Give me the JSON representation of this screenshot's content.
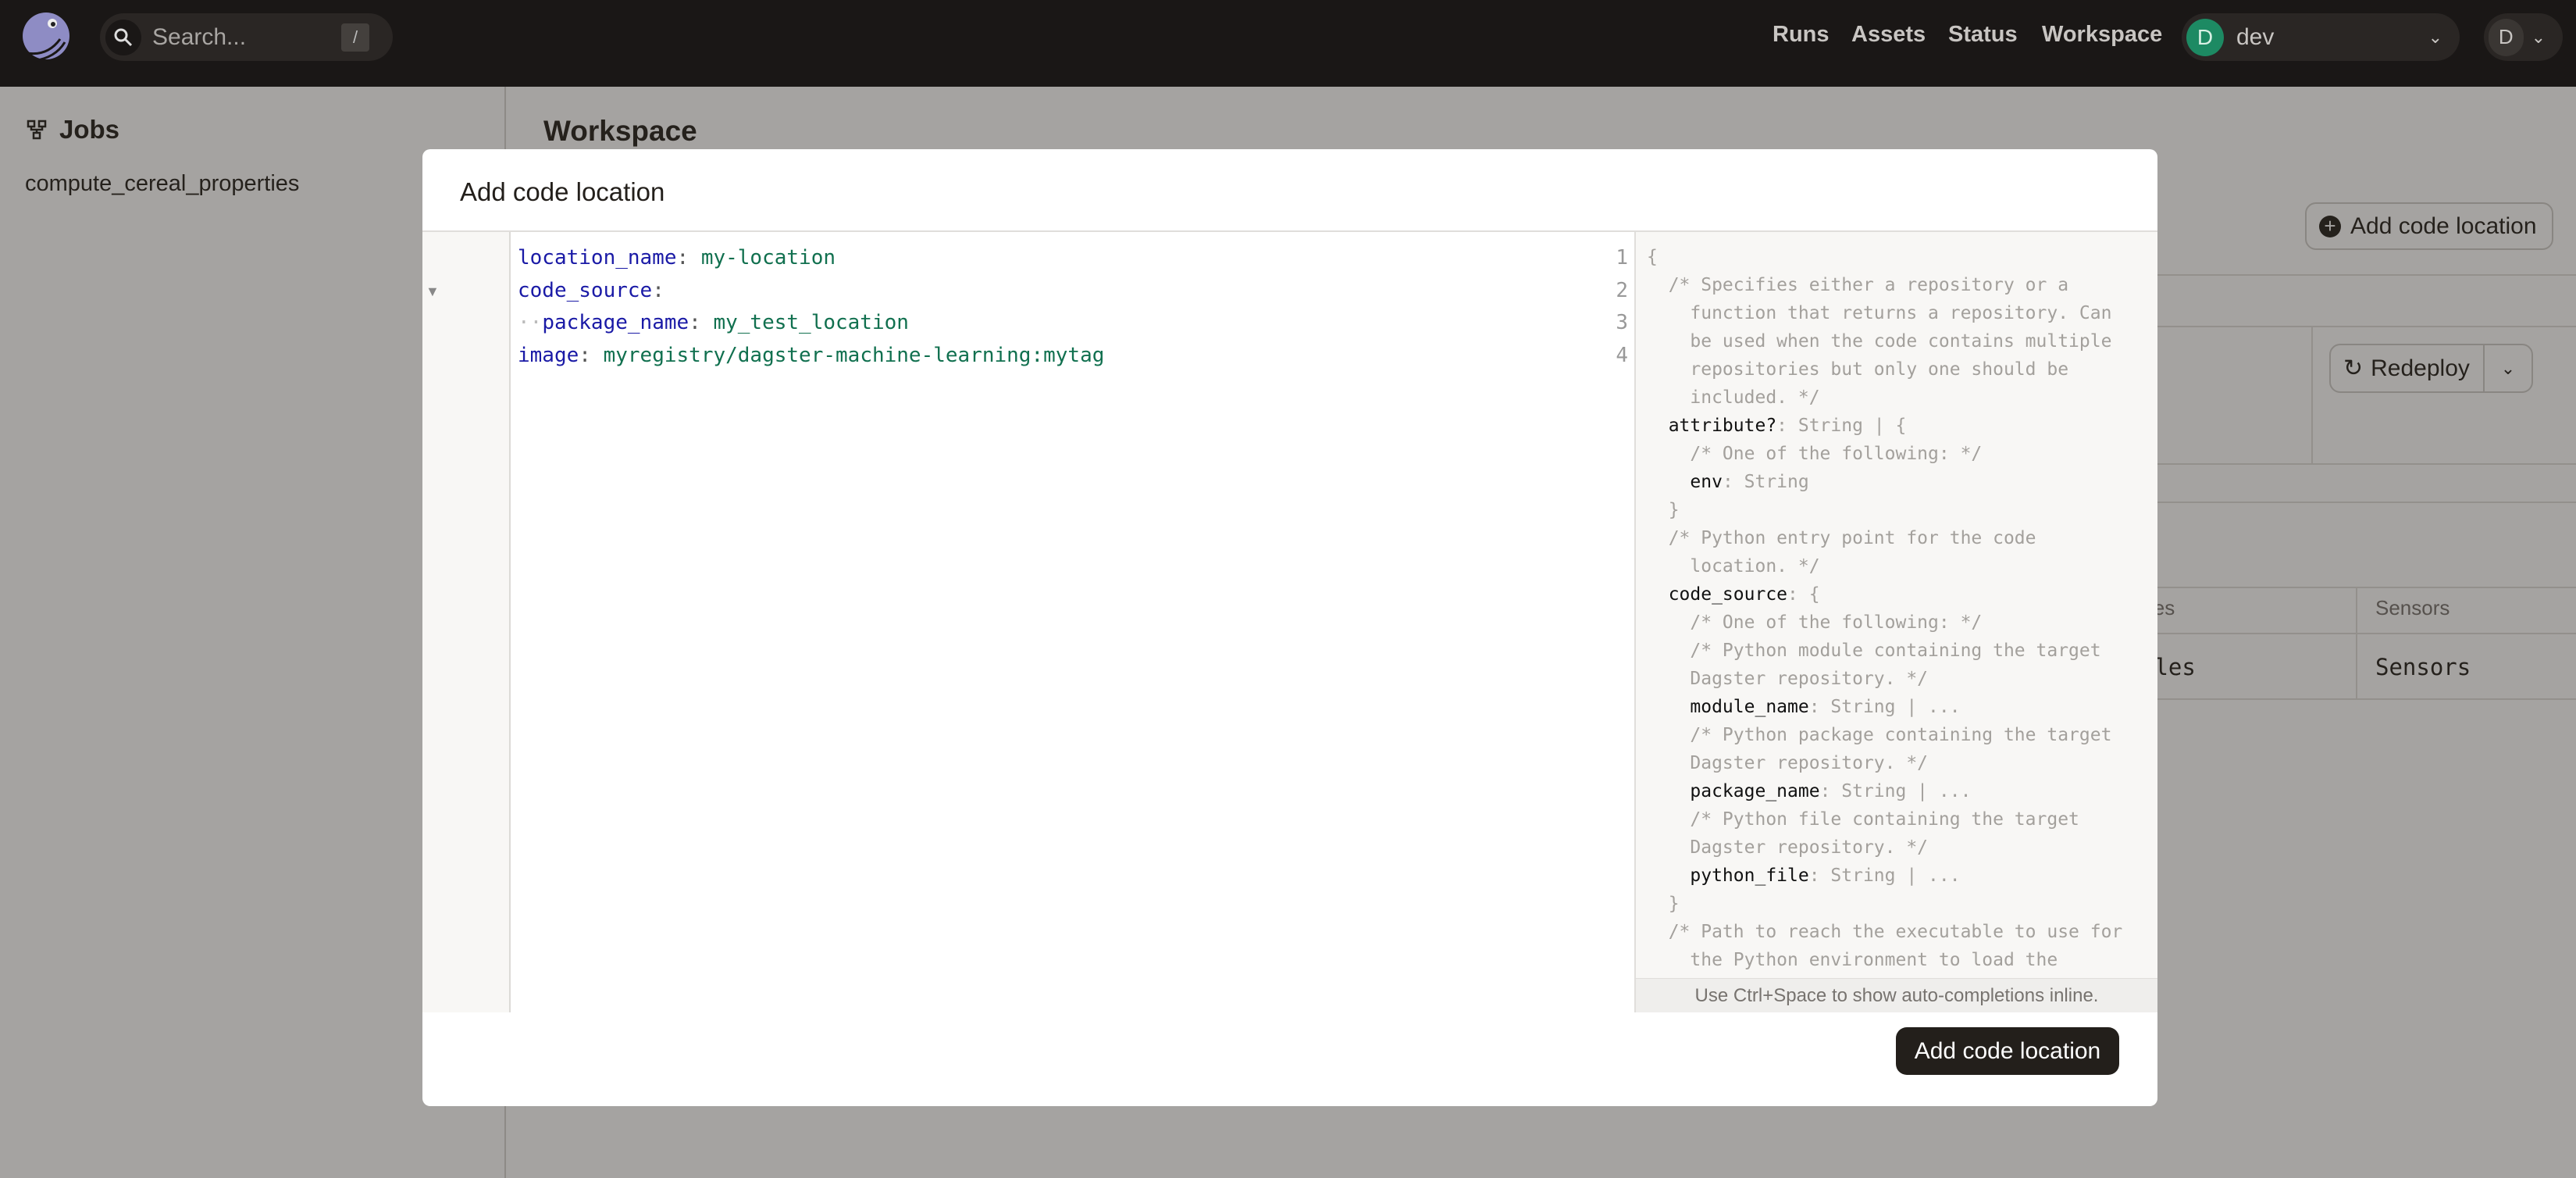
{
  "topbar": {
    "search_placeholder": "Search...",
    "search_shortcut": "/",
    "nav": [
      "Runs",
      "Assets",
      "Status",
      "Workspace"
    ],
    "deployment": {
      "initial": "D",
      "name": "dev"
    },
    "user_initial": "D"
  },
  "sidebar": {
    "title": "Jobs",
    "items": [
      "compute_cereal_properties"
    ]
  },
  "main": {
    "title": "Workspace",
    "add_button": "Add code location",
    "redeploy_button": "Redeploy",
    "table_headers": [
      "les",
      "Sensors"
    ],
    "table_row": [
      "ules",
      "Sensors"
    ]
  },
  "modal": {
    "title": "Add code location",
    "editor_lines": [
      {
        "num": "1",
        "key": "location_name",
        "value": "my-location"
      },
      {
        "num": "2",
        "key": "code_source",
        "value": ""
      },
      {
        "num": "3",
        "indent": "··",
        "key": "package_name",
        "value": "my_test_location"
      },
      {
        "num": "4",
        "key": "image",
        "value": "myregistry/dagster-machine-learning:mytag"
      }
    ],
    "help_lines": [
      {
        "text": "{"
      },
      {
        "text": "  /* Specifies either a repository or a"
      },
      {
        "text": "    function that returns a repository. Can"
      },
      {
        "text": "    be used when the code contains multiple"
      },
      {
        "text": "    repositories but only one should be"
      },
      {
        "text": "    included. */"
      },
      {
        "key": "  attribute?",
        "text": ": String | {"
      },
      {
        "text": "    /* One of the following: */"
      },
      {
        "key": "    env",
        "text": ": String"
      },
      {
        "text": "  }"
      },
      {
        "text": "  /* Python entry point for the code"
      },
      {
        "text": "    location. */"
      },
      {
        "key": "  code_source",
        "text": ": {"
      },
      {
        "text": "    /* One of the following: */"
      },
      {
        "text": "    /* Python module containing the target"
      },
      {
        "text": "    Dagster repository. */"
      },
      {
        "key": "    module_name",
        "text": ": String | ..."
      },
      {
        "text": "    /* Python package containing the target"
      },
      {
        "text": "    Dagster repository. */"
      },
      {
        "key": "    package_name",
        "text": ": String | ..."
      },
      {
        "text": "    /* Python file containing the target"
      },
      {
        "text": "    Dagster repository. */"
      },
      {
        "key": "    python_file",
        "text": ": String | ..."
      },
      {
        "text": "  }"
      },
      {
        "text": "  /* Path to reach the executable to use for"
      },
      {
        "text": "    the Python environment to load the"
      }
    ],
    "help_footer": "Use Ctrl+Space to show auto-completions inline.",
    "submit_button": "Add code location"
  }
}
